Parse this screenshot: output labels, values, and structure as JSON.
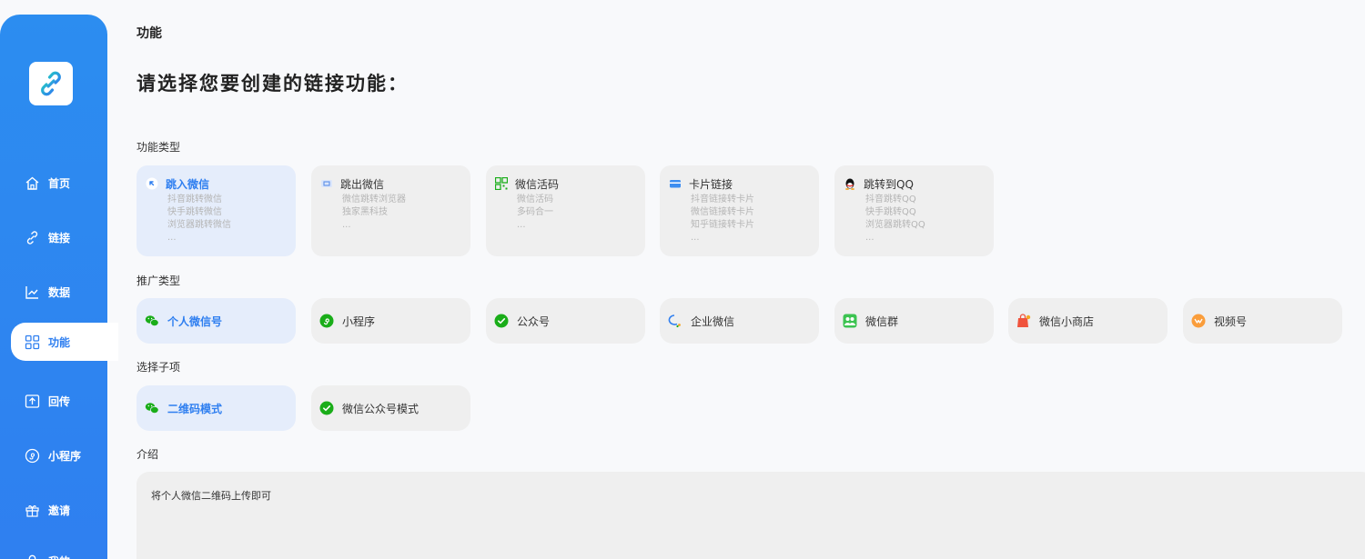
{
  "sidebar": {
    "logo_icon": "chain-link-icon",
    "items": [
      {
        "label": "首页",
        "icon": "home-icon"
      },
      {
        "label": "链接",
        "icon": "link-icon"
      },
      {
        "label": "数据",
        "icon": "chart-icon"
      },
      {
        "label": "功能",
        "icon": "grid-icon",
        "active": true
      },
      {
        "label": "回传",
        "icon": "upload-icon"
      },
      {
        "label": "小程序",
        "icon": "miniprogram-icon"
      },
      {
        "label": "邀请",
        "icon": "gift-icon"
      },
      {
        "label": "我的",
        "icon": "user-icon"
      }
    ]
  },
  "breadcrumb": "功能",
  "heading": "请选择您要创建的链接功能：",
  "function_section": {
    "label": "功能类型",
    "cards": [
      {
        "title": "跳入微信",
        "icon": "jump-in-icon",
        "desc": [
          "抖音跳转微信",
          "快手跳转微信",
          "浏览器跳转微信",
          "..."
        ],
        "active": true
      },
      {
        "title": "跳出微信",
        "icon": "jump-out-icon",
        "desc": [
          "微信跳转浏览器",
          "独家黑科技",
          "..."
        ]
      },
      {
        "title": "微信活码",
        "icon": "qrcode-icon",
        "desc": [
          "微信活码",
          "多码合一",
          "..."
        ]
      },
      {
        "title": "卡片链接",
        "icon": "card-icon",
        "desc": [
          "抖音链接转卡片",
          "微信链接转卡片",
          "知乎链接转卡片",
          "..."
        ]
      },
      {
        "title": "跳转到QQ",
        "icon": "qq-icon",
        "desc": [
          "抖音跳转QQ",
          "快手跳转QQ",
          "浏览器跳转QQ",
          "..."
        ]
      }
    ]
  },
  "promo_section": {
    "label": "推广类型",
    "items": [
      {
        "label": "个人微信号",
        "icon": "wechat-icon",
        "active": true
      },
      {
        "label": "小程序",
        "icon": "miniprogram-icon"
      },
      {
        "label": "公众号",
        "icon": "official-account-icon"
      },
      {
        "label": "企业微信",
        "icon": "wecom-icon"
      },
      {
        "label": "微信群",
        "icon": "wechat-group-icon"
      },
      {
        "label": "微信小商店",
        "icon": "shop-icon"
      },
      {
        "label": "视频号",
        "icon": "channels-icon"
      }
    ]
  },
  "sub_section": {
    "label": "选择子项",
    "items": [
      {
        "label": "二维码模式",
        "icon": "wechat-icon",
        "active": true
      },
      {
        "label": "微信公众号模式",
        "icon": "official-account-icon"
      }
    ]
  },
  "intro_section": {
    "label": "介绍",
    "text": "将个人微信二维码上传即可"
  },
  "colors": {
    "accent": "#2f7ff0",
    "wechat_green": "#1aad19",
    "card_bg": "#efefef",
    "card_active_bg": "#e5edfb"
  }
}
